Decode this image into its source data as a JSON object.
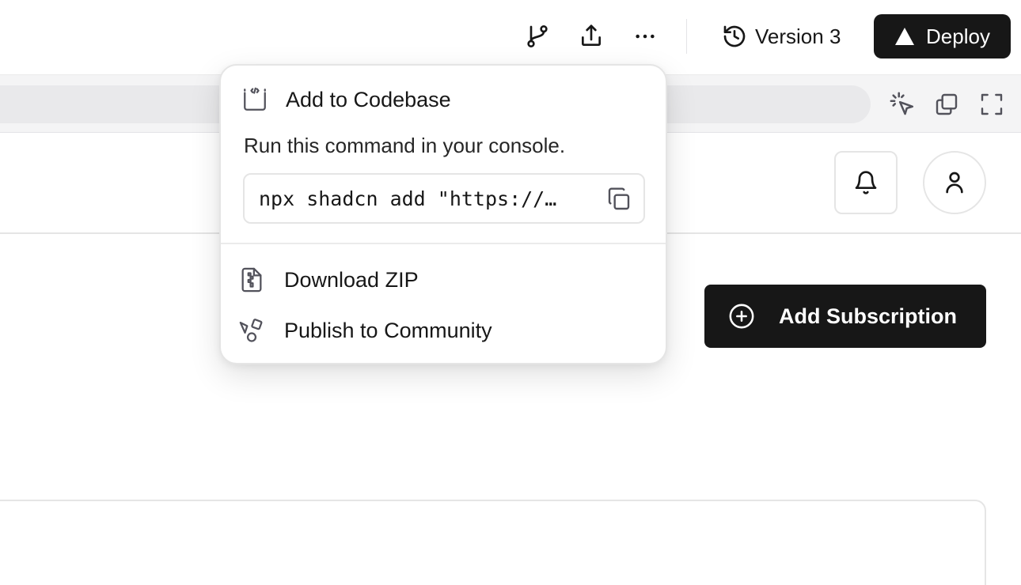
{
  "toolbar": {
    "version_label": "Version 3",
    "deploy_label": "Deploy",
    "icons": [
      "git-branch-icon",
      "share-icon",
      "more-icon",
      "history-icon",
      "triangle-icon"
    ]
  },
  "preview": {
    "icons": [
      "cursor-select-icon",
      "copy-window-icon",
      "fullscreen-icon"
    ]
  },
  "app": {
    "add_subscription_label": "Add Subscription",
    "icons": [
      "bell-icon",
      "user-icon",
      "plus-circle-icon"
    ]
  },
  "dropdown": {
    "title": "Add to Codebase",
    "description": "Run this command in your console.",
    "command": "npx shadcn add \"https://…",
    "items": [
      {
        "label": "Download ZIP",
        "icon": "file-zip-icon"
      },
      {
        "label": "Publish to Community",
        "icon": "shapes-icon"
      }
    ]
  },
  "colors": {
    "primary": "#171717",
    "border": "#e5e5e5",
    "muted_bg": "#f4f4f5"
  }
}
